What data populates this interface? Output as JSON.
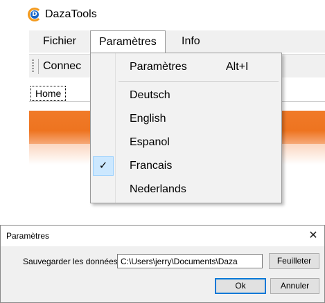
{
  "app": {
    "title": "DazaTools",
    "logo_letter": "D",
    "menu": {
      "file": "Fichier",
      "params": "Paramètres",
      "info": "Info"
    },
    "toolbar": {
      "connect": "Connec"
    },
    "tab": {
      "home": "Home"
    },
    "colors": {
      "banner": "#ee7420",
      "logo_ring": "#f39a1e",
      "logo_core": "#1b66c9"
    }
  },
  "dropdown": {
    "settings_item": {
      "label": "Paramètres",
      "shortcut": "Alt+I"
    },
    "languages": [
      {
        "label": "Deutsch",
        "checked": false
      },
      {
        "label": "English",
        "checked": false
      },
      {
        "label": "Espanol",
        "checked": false
      },
      {
        "label": "Francais",
        "checked": true
      },
      {
        "label": "Nederlands",
        "checked": false
      }
    ],
    "check_glyph": "✓"
  },
  "dialog": {
    "title": "Paramètres",
    "close_glyph": "✕",
    "save_label": "Sauvegarder les données:",
    "save_path": "C:\\Users\\jerry\\Documents\\Daza",
    "browse_button": "Feuilleter",
    "ok_button": "Ok",
    "cancel_button": "Annuler"
  }
}
